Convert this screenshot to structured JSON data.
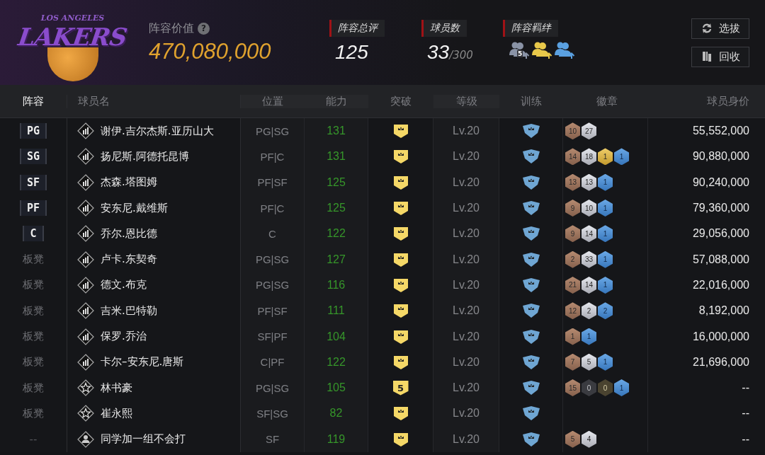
{
  "logo": {
    "top": "LOS ANGELES",
    "main": "LAKERS"
  },
  "lineup_value": {
    "label": "阵容价值",
    "help": "?",
    "value": "470,080,000"
  },
  "stats": [
    {
      "kind": "number",
      "label": "阵容总评",
      "value": "125"
    },
    {
      "kind": "count",
      "label": "球员数",
      "value": "33",
      "total": "/300"
    },
    {
      "kind": "bonds",
      "label": "阵容羁绊",
      "bonds": [
        {
          "color": "#8a93a6",
          "text": "5"
        },
        {
          "color": "#e8c84a"
        },
        {
          "color": "#5aa0e0"
        }
      ]
    }
  ],
  "buttons": [
    {
      "kind": "refresh",
      "label": "选拔"
    },
    {
      "kind": "recycle",
      "label": "回收"
    }
  ],
  "columns": [
    {
      "label": "阵容",
      "selected": true
    },
    {
      "label": "球员名",
      "selected": false
    },
    {
      "label": "位置",
      "selected": false
    },
    {
      "label": "能力",
      "selected": false
    },
    {
      "label": "突破",
      "selected": false
    },
    {
      "label": "等级",
      "selected": false
    },
    {
      "label": "训练",
      "selected": false
    },
    {
      "label": "徽章",
      "selected": false
    },
    {
      "label": "球员身价",
      "selected": false
    }
  ],
  "rows": [
    {
      "lineup": {
        "kind": "starter",
        "text": "PG"
      },
      "kind": "bars",
      "name": "谢伊.吉尔杰斯.亚历山大",
      "position": "PG|SG",
      "ability": "131",
      "breakthrough": {
        "kind": "crown"
      },
      "level": "Lv.20",
      "badges": [
        {
          "kind": "bronze",
          "text": "10"
        },
        {
          "kind": "silver",
          "text": "27"
        }
      ],
      "value": "55,552,000"
    },
    {
      "lineup": {
        "kind": "starter",
        "text": "SG"
      },
      "kind": "bars",
      "name": "扬尼斯.阿德托昆博",
      "position": "PF|C",
      "ability": "131",
      "breakthrough": {
        "kind": "crown"
      },
      "level": "Lv.20",
      "badges": [
        {
          "kind": "bronze",
          "text": "14"
        },
        {
          "kind": "silver",
          "text": "18"
        },
        {
          "kind": "gold",
          "text": "1"
        },
        {
          "kind": "blue",
          "text": "1"
        }
      ],
      "value": "90,880,000"
    },
    {
      "lineup": {
        "kind": "starter",
        "text": "SF"
      },
      "kind": "bars",
      "name": "杰森.塔图姆",
      "position": "PF|SF",
      "ability": "125",
      "breakthrough": {
        "kind": "crown"
      },
      "level": "Lv.20",
      "badges": [
        {
          "kind": "bronze",
          "text": "13"
        },
        {
          "kind": "silver",
          "text": "13"
        },
        {
          "kind": "blue",
          "text": "1"
        }
      ],
      "value": "90,240,000"
    },
    {
      "lineup": {
        "kind": "starter",
        "text": "PF"
      },
      "kind": "bars",
      "name": "安东尼.戴维斯",
      "position": "PF|C",
      "ability": "125",
      "breakthrough": {
        "kind": "crown"
      },
      "level": "Lv.20",
      "badges": [
        {
          "kind": "bronze",
          "text": "9"
        },
        {
          "kind": "silver",
          "text": "10"
        },
        {
          "kind": "blue",
          "text": "1"
        }
      ],
      "value": "79,360,000"
    },
    {
      "lineup": {
        "kind": "starter",
        "text": "C"
      },
      "kind": "bars",
      "name": "乔尔.恩比德",
      "position": "C",
      "ability": "122",
      "breakthrough": {
        "kind": "crown"
      },
      "level": "Lv.20",
      "badges": [
        {
          "kind": "bronze",
          "text": "9"
        },
        {
          "kind": "silver",
          "text": "14"
        },
        {
          "kind": "blue",
          "text": "1"
        }
      ],
      "value": "29,056,000"
    },
    {
      "lineup": {
        "kind": "bench",
        "text": "板凳"
      },
      "kind": "bars",
      "name": "卢卡.东契奇",
      "position": "PG|SG",
      "ability": "127",
      "breakthrough": {
        "kind": "crown"
      },
      "level": "Lv.20",
      "badges": [
        {
          "kind": "bronze",
          "text": "2"
        },
        {
          "kind": "silver",
          "text": "33"
        },
        {
          "kind": "blue",
          "text": "1"
        }
      ],
      "value": "57,088,000"
    },
    {
      "lineup": {
        "kind": "bench",
        "text": "板凳"
      },
      "kind": "bars",
      "name": "德文.布克",
      "position": "PG|SG",
      "ability": "116",
      "breakthrough": {
        "kind": "crown"
      },
      "level": "Lv.20",
      "badges": [
        {
          "kind": "bronze",
          "text": "21"
        },
        {
          "kind": "silver",
          "text": "14"
        },
        {
          "kind": "blue",
          "text": "1"
        }
      ],
      "value": "22,016,000"
    },
    {
      "lineup": {
        "kind": "bench",
        "text": "板凳"
      },
      "kind": "bars",
      "name": "吉米.巴特勒",
      "position": "PF|SF",
      "ability": "111",
      "breakthrough": {
        "kind": "crown"
      },
      "level": "Lv.20",
      "badges": [
        {
          "kind": "bronze",
          "text": "12"
        },
        {
          "kind": "silver",
          "text": "2"
        },
        {
          "kind": "blue",
          "text": "2"
        }
      ],
      "value": "8,192,000"
    },
    {
      "lineup": {
        "kind": "bench",
        "text": "板凳"
      },
      "kind": "bars",
      "name": "保罗.乔治",
      "position": "SF|PF",
      "ability": "104",
      "breakthrough": {
        "kind": "crown"
      },
      "level": "Lv.20",
      "badges": [
        {
          "kind": "bronze",
          "text": "1"
        },
        {
          "kind": "blue",
          "text": "1"
        }
      ],
      "value": "16,000,000"
    },
    {
      "lineup": {
        "kind": "bench",
        "text": "板凳"
      },
      "kind": "bars",
      "name": "卡尔–安东尼.唐斯",
      "position": "C|PF",
      "ability": "122",
      "breakthrough": {
        "kind": "crown"
      },
      "level": "Lv.20",
      "badges": [
        {
          "kind": "bronze",
          "text": "7"
        },
        {
          "kind": "silver",
          "text": "5"
        },
        {
          "kind": "blue",
          "text": "1"
        }
      ],
      "value": "21,696,000"
    },
    {
      "lineup": {
        "kind": "bench",
        "text": "板凳"
      },
      "kind": "star",
      "name": "林书豪",
      "position": "PG|SG",
      "ability": "105",
      "breakthrough": {
        "kind": "number",
        "text": "5"
      },
      "level": "Lv.20",
      "badges": [
        {
          "kind": "bronze",
          "text": "15"
        },
        {
          "kind": "silver_empty",
          "text": "0"
        },
        {
          "kind": "gold_empty",
          "text": "0"
        },
        {
          "kind": "blue",
          "text": "1"
        }
      ],
      "value": "--"
    },
    {
      "lineup": {
        "kind": "bench",
        "text": "板凳"
      },
      "kind": "star",
      "name": "崔永熙",
      "position": "SF|SG",
      "ability": "82",
      "breakthrough": {
        "kind": "crown"
      },
      "level": "Lv.20",
      "badges": [],
      "value": "--"
    },
    {
      "lineup": {
        "kind": "none",
        "text": "--"
      },
      "kind": "person",
      "name": "同学加一组不会打",
      "position": "SF",
      "ability": "119",
      "breakthrough": {
        "kind": "crown"
      },
      "level": "Lv.20",
      "badges": [
        {
          "kind": "bronze",
          "text": "5"
        },
        {
          "kind": "silver",
          "text": "4"
        }
      ],
      "value": "--"
    }
  ]
}
